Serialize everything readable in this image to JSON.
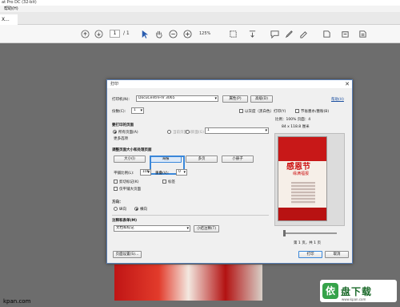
{
  "window": {
    "title": "at Pro DC (32-bit)"
  },
  "menu": {
    "items": [
      "帮助(H)"
    ]
  },
  "tab": {
    "label": "X..."
  },
  "toolbar": {
    "page_current": "1",
    "page_total": "/ 1",
    "zoom": "125%"
  },
  "dialog": {
    "title": "打印",
    "close": "✕",
    "printer_label": "打印机(N):",
    "printer_value": "DocuCentre-IV 3065",
    "properties_btn": "属性(P)",
    "advanced_btn": "高级(D)",
    "help_link": "帮助(H)",
    "copies_label": "份数(C):",
    "copies_value": "1",
    "grayscale_label": "以灰度（黑白色）打印(Y)",
    "save_ink_label": "节省墨水/墨粉(B)",
    "pages_section": "要打印的页面",
    "all_pages": "所有页面(A)",
    "current_page": "当前页面(U)",
    "pages_option": "页面(G)",
    "pages_value": "1",
    "more_options": "更多选项",
    "sizing_section": "调整页面大小和处理页面",
    "sizing_buttons": [
      "大小(I)",
      "海报",
      "多页",
      "小册子"
    ],
    "scale_label": "平铺比例(L):",
    "scale_value": "100",
    "overlap_label": "重叠(V):",
    "overlap_value": "0",
    "cut_marks": "剪切标记(K)",
    "labels": "标签",
    "tile_large": "仅平铺大页面",
    "orientation_section": "方向：",
    "portrait": "纵向",
    "landscape": "横向",
    "comments_section": "注释和表单(M)",
    "comments_value": "文档和标记",
    "summarize_btn": "小结注释(T)",
    "preview_scale": "比例：100% 页面：4",
    "preview_size": "84 x 118.8 厘米",
    "poster_title": "感恩节",
    "poster_sub": "缘满福报",
    "page_indicator": "第 1 页，共 1 页",
    "page_setup_btn": "页面设置(S)...",
    "print_btn": "打印",
    "cancel_btn": "取消"
  },
  "watermark": {
    "left": "kpan.com",
    "logo_char": "依",
    "logo_text": "盘下载",
    "logo_sub": "www.kpan.com"
  }
}
